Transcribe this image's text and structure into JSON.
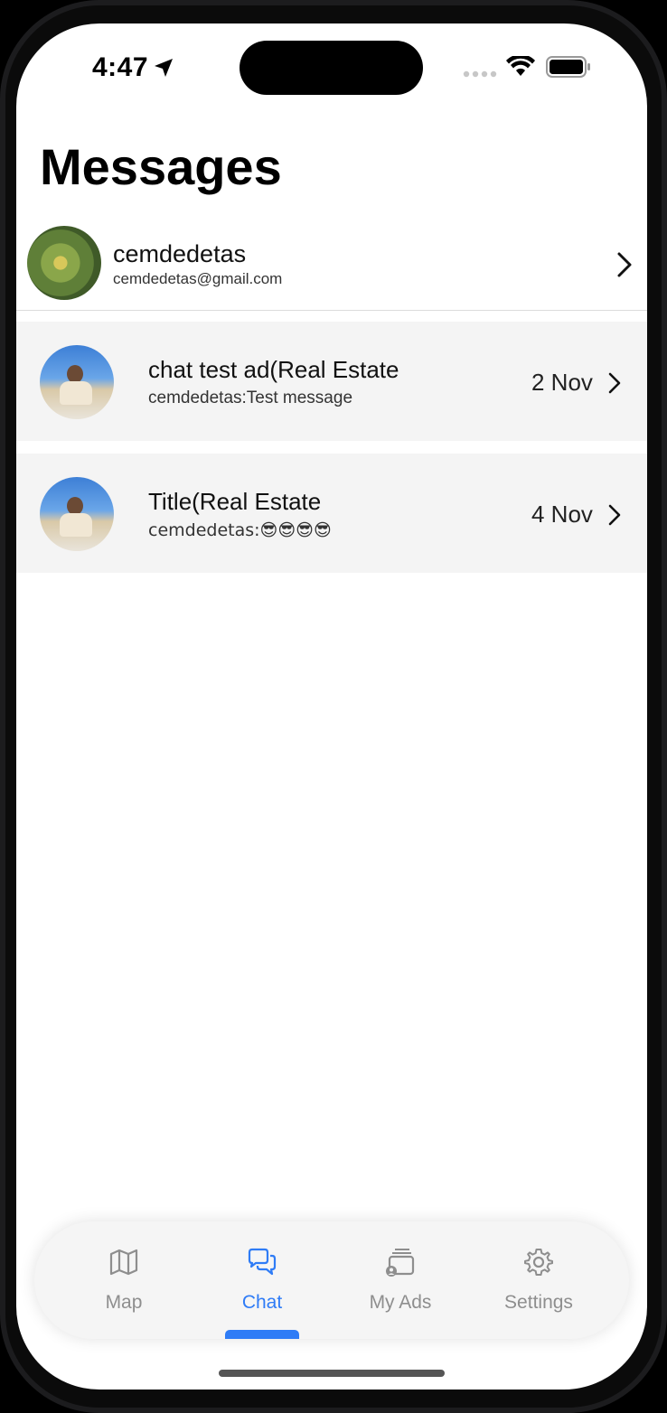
{
  "status_bar": {
    "time": "4:47"
  },
  "page": {
    "title": "Messages"
  },
  "profile": {
    "name": "cemdedetas",
    "email": "cemdedetas@gmail.com"
  },
  "conversations": [
    {
      "title": "chat test ad(Real Estate",
      "preview": "cemdedetas:Test message",
      "date": "2 Nov"
    },
    {
      "title": "Title(Real Estate",
      "preview": "cemdedetas:😎😎😎😎",
      "date": "4 Nov"
    }
  ],
  "tab_bar": {
    "items": [
      {
        "label": "Map",
        "icon": "map-icon",
        "active": false
      },
      {
        "label": "Chat",
        "icon": "chat-bubbles-icon",
        "active": true
      },
      {
        "label": "My Ads",
        "icon": "my-ads-icon",
        "active": false
      },
      {
        "label": "Settings",
        "icon": "gear-icon",
        "active": false
      }
    ]
  },
  "colors": {
    "accent": "#2f7cf6",
    "inactive_tab": "#8e8e8e",
    "row_background": "#f4f4f4"
  }
}
